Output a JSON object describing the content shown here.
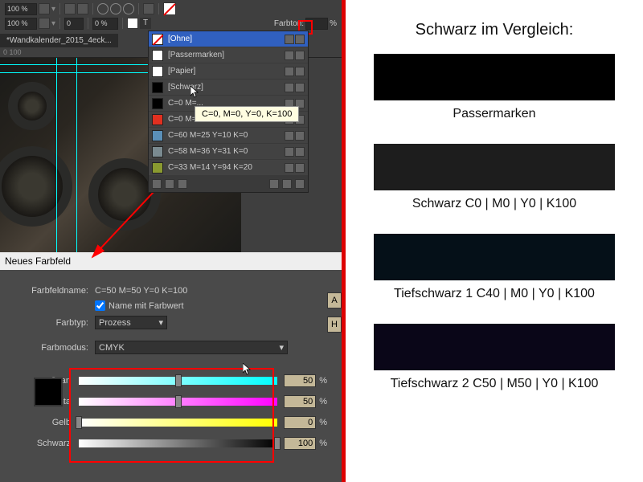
{
  "toolbar": {
    "zoom1": "100 %",
    "zoom2": "100 %",
    "sel1": "0",
    "sel2": "0 %",
    "tint_label": "Farbton:",
    "tint_val": "%"
  },
  "doc": {
    "tab": "*Wandkalender_2015_4eck...",
    "ruler": "0            100"
  },
  "swatches": {
    "items": [
      {
        "name": "[Ohne]",
        "color": "transparent",
        "sel": true
      },
      {
        "name": "[Passermarken]",
        "color": "#fff"
      },
      {
        "name": "[Papier]",
        "color": "#fff"
      },
      {
        "name": "[Schwarz]",
        "color": "#000"
      },
      {
        "name": "C=0 M=...",
        "color": "#000"
      },
      {
        "name": "C=0 M=...",
        "color": "#e03020"
      },
      {
        "name": "C=60 M=25 Y=10 K=0",
        "color": "#5a8fb8"
      },
      {
        "name": "C=58 M=36 Y=31 K=0",
        "color": "#7a8a90"
      },
      {
        "name": "C=33 M=14 Y=94 K=20",
        "color": "#8a9a30"
      }
    ]
  },
  "tooltip": "C=0, M=0, Y=0, K=100",
  "dialog": {
    "title": "Neues Farbfeld",
    "name_label": "Farbfeldname:",
    "name_value": "C=50 M=50 Y=0 K=100",
    "checkbox": "Name mit Farbwert",
    "type_label": "Farbtyp:",
    "type_value": "Prozess",
    "mode_label": "Farbmodus:",
    "mode_value": "CMYK",
    "btn_a": "A",
    "btn_h": "H",
    "sliders": [
      {
        "label": "Cyan",
        "cls": "c",
        "val": "50",
        "pos": 50
      },
      {
        "label": "Magenta",
        "cls": "m",
        "val": "50",
        "pos": 50
      },
      {
        "label": "Gelb",
        "cls": "y",
        "val": "0",
        "pos": 0
      },
      {
        "label": "Schwarz",
        "cls": "k",
        "val": "100",
        "pos": 100
      }
    ]
  },
  "comparison": {
    "title": "Schwarz im Vergleich:",
    "items": [
      {
        "label": "Passermarken",
        "color": "#000000"
      },
      {
        "label": "Schwarz C0 | M0 | Y0 | K100",
        "color": "#1d1d1d"
      },
      {
        "label": "Tiefschwarz 1 C40 | M0 | Y0 | K100",
        "color": "#051018"
      },
      {
        "label": "Tiefschwarz 2 C50 | M50 | Y0 | K100",
        "color": "#0a0618"
      }
    ]
  }
}
